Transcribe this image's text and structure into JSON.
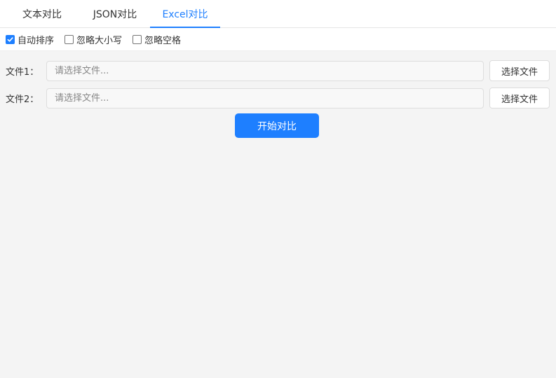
{
  "tabs": [
    {
      "label": "文本对比",
      "active": false
    },
    {
      "label": "JSON对比",
      "active": false
    },
    {
      "label": "Excel对比",
      "active": true
    }
  ],
  "options": [
    {
      "label": "自动排序",
      "checked": true
    },
    {
      "label": "忽略大小写",
      "checked": false
    },
    {
      "label": "忽略空格",
      "checked": false
    }
  ],
  "files": [
    {
      "label": "文件1：",
      "placeholder": "请选择文件...",
      "button": "选择文件"
    },
    {
      "label": "文件2：",
      "placeholder": "请选择文件...",
      "button": "选择文件"
    }
  ],
  "start_button": "开始对比",
  "colors": {
    "accent": "#1e7fff",
    "background": "#f4f4f4"
  }
}
